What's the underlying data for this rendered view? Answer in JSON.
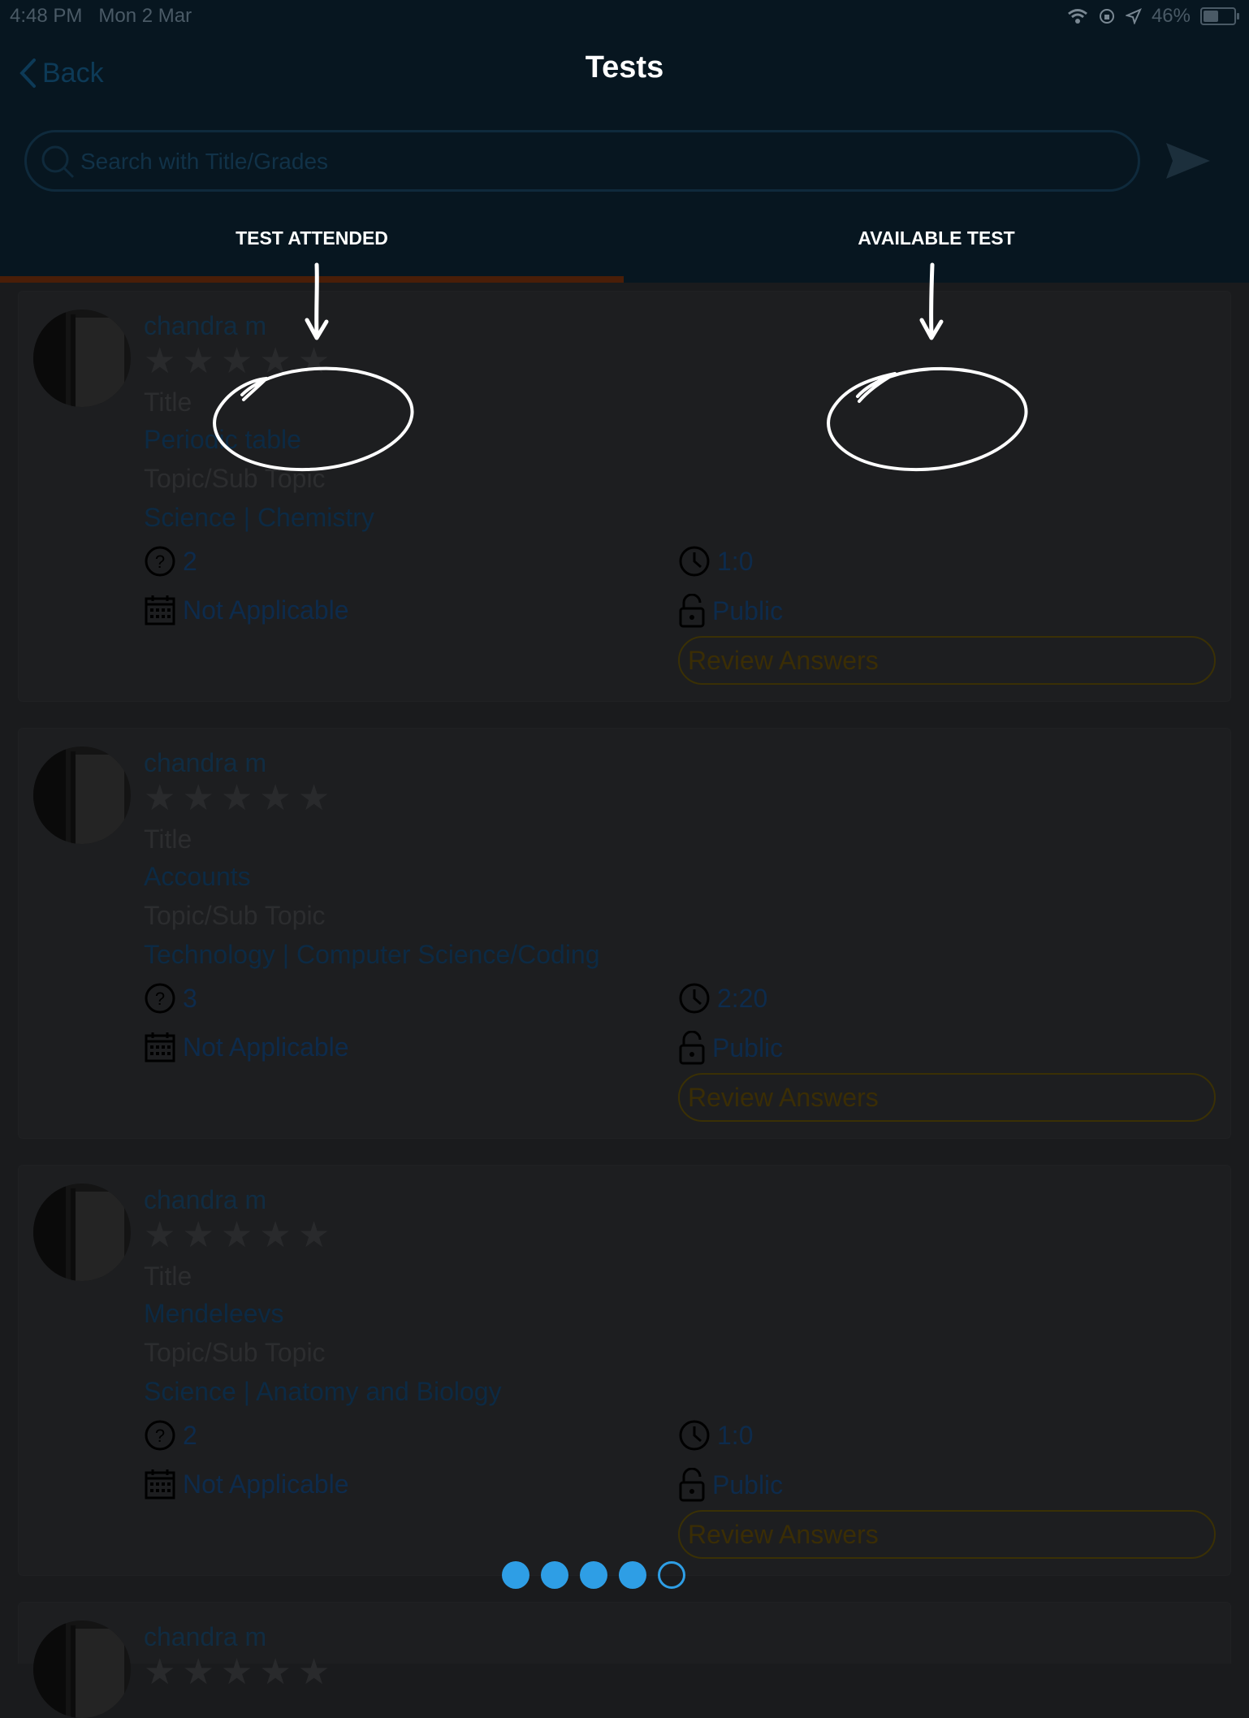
{
  "status_bar": {
    "time": "4:48 PM",
    "date": "Mon 2 Mar",
    "battery": "46%",
    "battery_level": 0.46
  },
  "nav": {
    "back_label": "Back",
    "title": "Tests"
  },
  "search": {
    "placeholder": "Search with Title/Grades"
  },
  "tabs": [
    {
      "label": "TEST ATTENDED",
      "selected": true
    },
    {
      "label": "AVAILABLE TEST",
      "selected": false
    }
  ],
  "labels": {
    "title": "Title",
    "topic": "Topic/Sub Topic",
    "review": "Review Answers"
  },
  "cards": [
    {
      "author": "chandra m",
      "title": "Periodic table",
      "topic": "Science | Chemistry",
      "questions": "2",
      "duration": "1:0",
      "due": "Not Applicable",
      "access": "Public"
    },
    {
      "author": "chandra m",
      "title": "Accounts",
      "topic": "Technology | Computer Science/Coding",
      "questions": "3",
      "duration": "2:20",
      "due": "Not Applicable",
      "access": "Public"
    },
    {
      "author": "chandra m",
      "title": "Mendeleevs",
      "topic": "Science | Anatomy and Biology",
      "questions": "2",
      "duration": "1:0",
      "due": "Not Applicable",
      "access": "Public"
    },
    {
      "author": "chandra m"
    }
  ],
  "pagination": {
    "total": 5,
    "current": 5
  },
  "colors": {
    "accent": "#2e9ee5",
    "tab_indicator": "#4a1e08",
    "header": "#071620",
    "annotation": "#ffffff"
  }
}
